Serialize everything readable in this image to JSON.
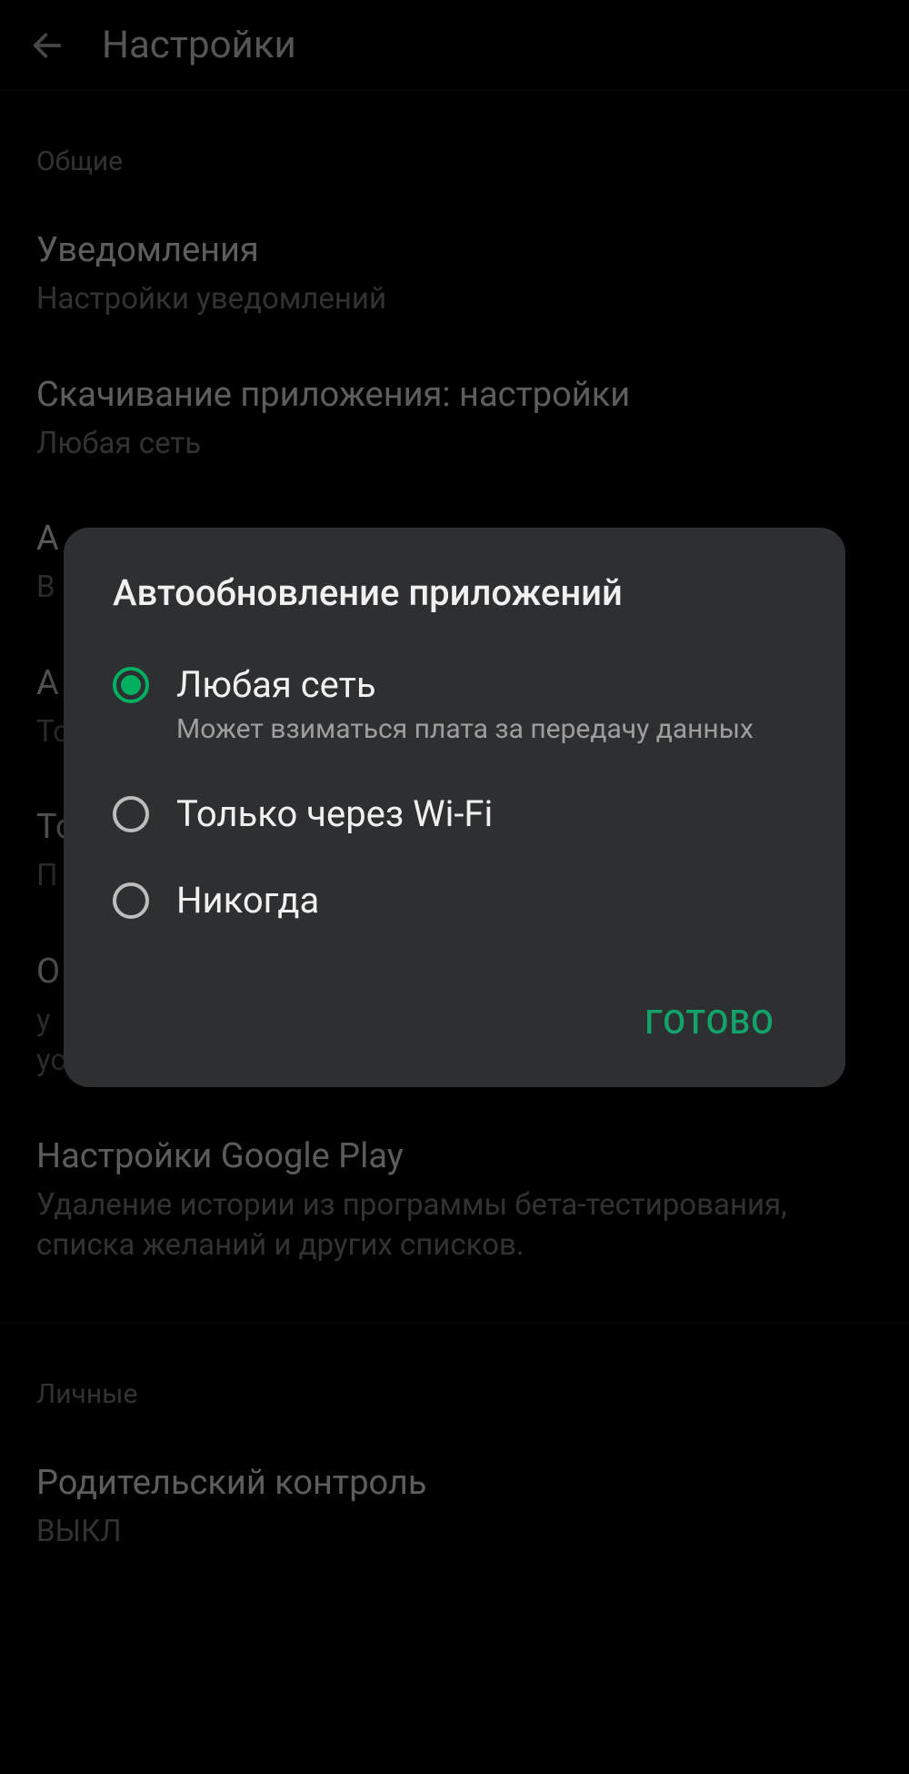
{
  "header": {
    "title": "Настройки"
  },
  "sections": {
    "general_label": "Общие",
    "personal_label": "Личные"
  },
  "items": {
    "notifications": {
      "title": "Уведомления",
      "subtitle": "Настройки уведомлений"
    },
    "download_prefs": {
      "title": "Скачивание приложения: настройки",
      "subtitle": "Любая сеть"
    },
    "auto_update": {
      "title": "А",
      "subtitle": "В"
    },
    "auto_play": {
      "title": "А",
      "subtitle": "То"
    },
    "theme": {
      "title": "То",
      "subtitle": "П"
    },
    "clear": {
      "title": "О",
      "subtitle_line1": "у",
      "subtitle_line2": "устройстве"
    },
    "play_settings": {
      "title": "Настройки Google Play",
      "subtitle": "Удаление истории из программы бета-тестирования, списка желаний и других списков."
    },
    "parental": {
      "title": "Родительский контроль",
      "subtitle": "ВЫКЛ"
    }
  },
  "dialog": {
    "title": "Автообновление приложений",
    "options": [
      {
        "label": "Любая сеть",
        "desc": "Может взиматься плата за передачу данных",
        "selected": true
      },
      {
        "label": "Только через Wi-Fi",
        "desc": "",
        "selected": false
      },
      {
        "label": "Никогда",
        "desc": "",
        "selected": false
      }
    ],
    "confirm": "ГОТОВО"
  },
  "colors": {
    "accent": "#00b060",
    "dialog_bg": "#2d2f31",
    "bg": "#000000"
  }
}
